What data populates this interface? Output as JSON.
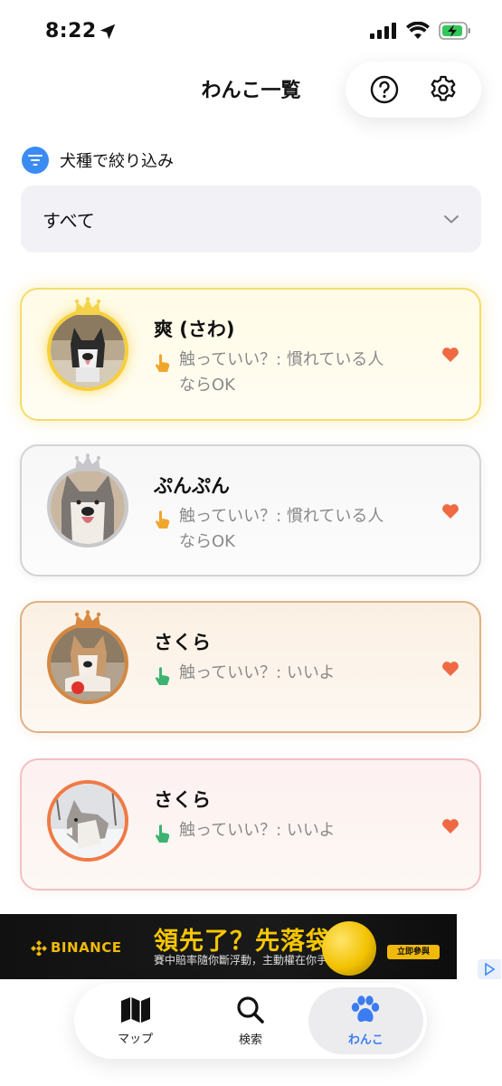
{
  "status_bar": {
    "time": "8:22"
  },
  "header": {
    "title": "わんこ一覧"
  },
  "filter": {
    "label": "犬種で絞り込み",
    "selected": "すべて"
  },
  "dogs": [
    {
      "name": "爽 (さわ)",
      "touch_text": "触っていい？: 慣れている人ならOK",
      "rank": "gold",
      "hand_color": "#f0a62c"
    },
    {
      "name": "ぷんぷん",
      "touch_text": "触っていい？: 慣れている人ならOK",
      "rank": "silver",
      "hand_color": "#f0a62c"
    },
    {
      "name": "さくら",
      "touch_text": "触っていい？: いいよ",
      "rank": "bronze",
      "hand_color": "#3cb371"
    },
    {
      "name": "さくら",
      "touch_text": "触っていい？: いいよ",
      "rank": "none",
      "hand_color": "#3cb371"
    }
  ],
  "ad": {
    "brand": "BINANCE",
    "headline": "領先了？先落袋",
    "subtext": "賽中賠率隨你斷浮動，主動權在你手上",
    "cta": "立即參與"
  },
  "tabs": [
    {
      "label": "マップ",
      "icon": "map-icon",
      "active": false
    },
    {
      "label": "検索",
      "icon": "search-icon",
      "active": false
    },
    {
      "label": "わんこ",
      "icon": "paw-icon",
      "active": true
    }
  ],
  "colors": {
    "accent": "#3b7cf0",
    "heart": "#ef6a43",
    "gold": "#f4dc6a",
    "bronze": "#dcb285",
    "pink": "#f1c0c4"
  }
}
